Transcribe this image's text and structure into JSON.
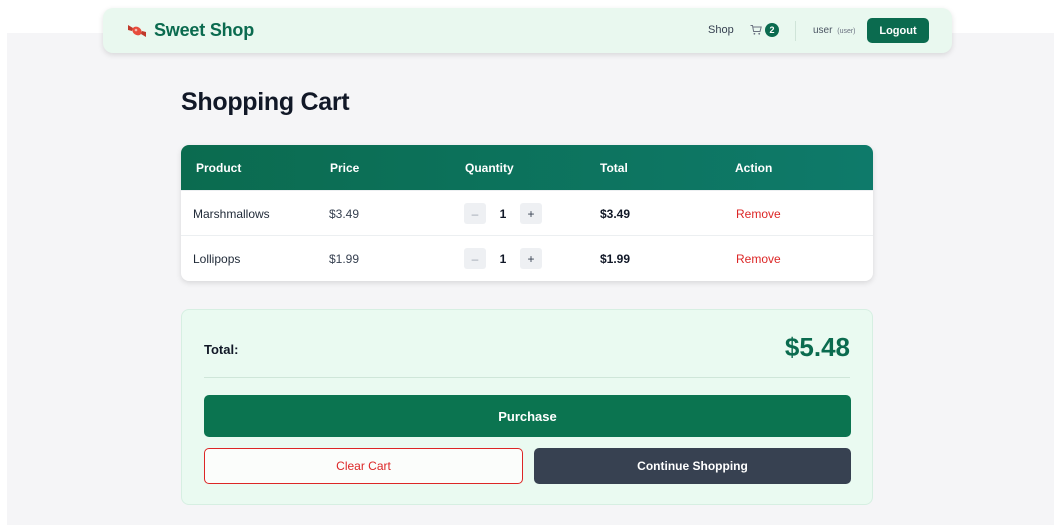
{
  "header": {
    "brand": "Sweet Shop",
    "brand_icon": "candy-icon",
    "nav_shop": "Shop",
    "cart_icon": "cart-icon",
    "cart_count": "2",
    "user_name": "user",
    "user_role": "(user)",
    "logout_label": "Logout"
  },
  "page": {
    "title": "Shopping Cart"
  },
  "table": {
    "headers": [
      "Product",
      "Price",
      "Quantity",
      "Total",
      "Action"
    ],
    "rows": [
      {
        "product": "Marshmallows",
        "price": "$3.49",
        "qty": "1",
        "total": "$3.49",
        "action": "Remove"
      },
      {
        "product": "Lollipops",
        "price": "$1.99",
        "qty": "1",
        "total": "$1.99",
        "action": "Remove"
      }
    ],
    "qty_minus": "–",
    "qty_plus": "+"
  },
  "summary": {
    "total_label": "Total:",
    "total_value": "$5.48",
    "purchase_label": "Purchase",
    "clear_label": "Clear Cart",
    "continue_label": "Continue Shopping"
  },
  "colors": {
    "brand_green": "#0b6b4f",
    "danger_red": "#dc2626",
    "dark_button": "#374151",
    "summary_bg": "#eafaf1"
  }
}
